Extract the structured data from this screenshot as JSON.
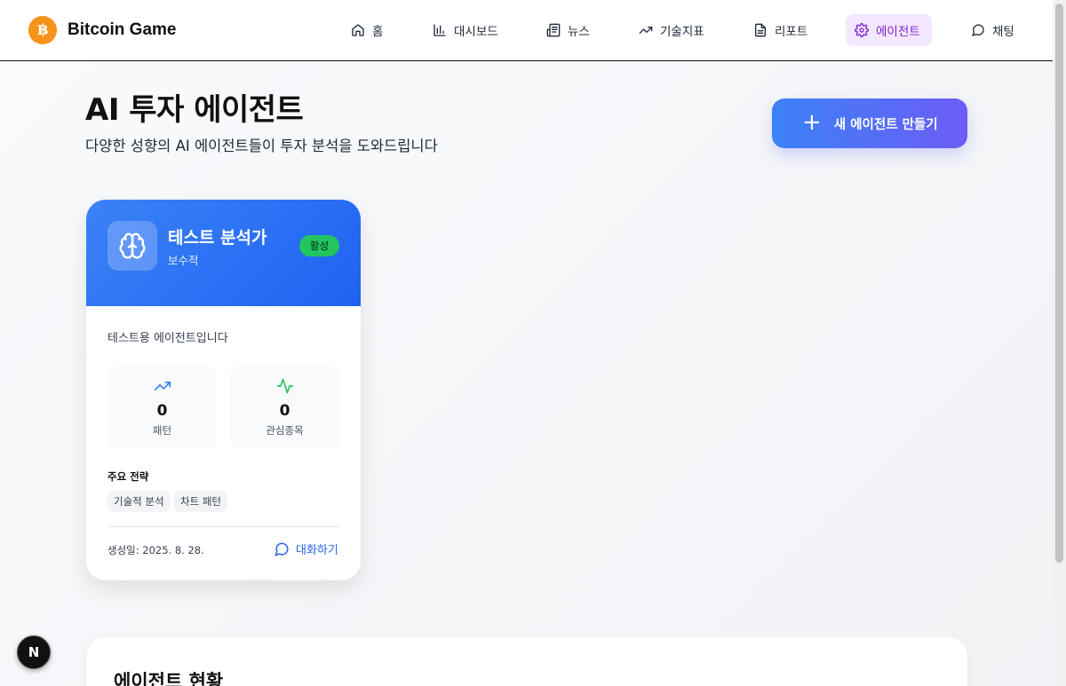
{
  "app": {
    "logo_glyph": "฿",
    "name": "Bitcoin Game"
  },
  "nav": {
    "items": [
      {
        "label": "홈",
        "icon": "home-icon"
      },
      {
        "label": "대시보드",
        "icon": "bar-chart-icon"
      },
      {
        "label": "뉴스",
        "icon": "newspaper-icon"
      },
      {
        "label": "기술지표",
        "icon": "trending-up-icon"
      },
      {
        "label": "리포트",
        "icon": "file-text-icon"
      },
      {
        "label": "에이전트",
        "icon": "gear-icon",
        "active": true
      },
      {
        "label": "채팅",
        "icon": "message-circle-icon"
      }
    ]
  },
  "header": {
    "title": "AI 투자 에이전트",
    "subtitle": "다양한 성향의 AI 에이전트들이 투자 분석을 도와드립니다",
    "new_agent_label": "새 에이전트 만들기"
  },
  "agent_card": {
    "name": "테스트 분석가",
    "type": "보수적",
    "status": "활성",
    "description": "테스트용 에이전트입니다",
    "stats": [
      {
        "value": "0",
        "label": "패턴",
        "icon": "trending-up-icon"
      },
      {
        "value": "0",
        "label": "관심종목",
        "icon": "activity-icon"
      }
    ],
    "strategy_title": "주요 전략",
    "strategies": [
      "기술적 분석",
      "차트 패턴"
    ],
    "created": "생성일: 2025. 8. 28.",
    "chat_label": "대화하기"
  },
  "summary": {
    "title": "에이전트 현황"
  },
  "dev_indicator": "N",
  "colors": {
    "accent": "#3b82f6",
    "active_nav_bg": "#f3e8ff",
    "active_nav_text": "#7e22ce",
    "status_green": "#22c55e",
    "bitcoin_orange": "#f7931a"
  }
}
